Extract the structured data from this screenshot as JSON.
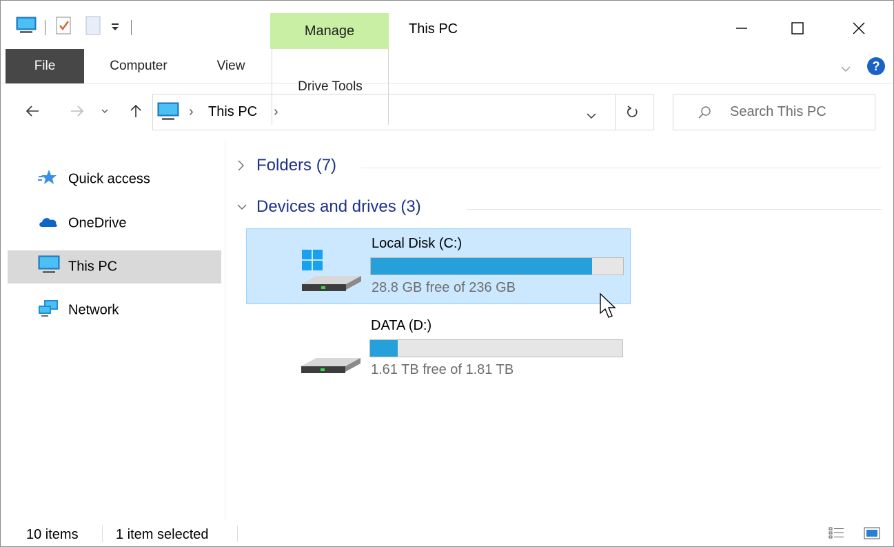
{
  "window": {
    "title": "This PC",
    "manage_label": "Manage",
    "minimize_icon": "minimize-icon",
    "maximize_icon": "maximize-icon",
    "close_icon": "close-icon"
  },
  "ribbon": {
    "tabs": [
      {
        "label": "File",
        "active": true
      },
      {
        "label": "Computer"
      },
      {
        "label": "View"
      },
      {
        "label": "Drive Tools"
      }
    ],
    "help_icon": "help-icon"
  },
  "address": {
    "path": "This PC",
    "search_placeholder": "Search This PC"
  },
  "sidebar": {
    "items": [
      {
        "label": "Quick access",
        "icon": "star-icon"
      },
      {
        "label": "OneDrive",
        "icon": "cloud-icon"
      },
      {
        "label": "This PC",
        "icon": "computer-icon",
        "selected": true
      },
      {
        "label": "Network",
        "icon": "network-icon"
      }
    ]
  },
  "content": {
    "groups": [
      {
        "title": "Folders (7)",
        "expanded": false
      },
      {
        "title": "Devices and drives (3)",
        "expanded": true
      }
    ],
    "drives": [
      {
        "name": "Local Disk (C:)",
        "free_text": "28.8 GB free of 236 GB",
        "used_fraction": 0.878,
        "selected": true
      },
      {
        "name": "DATA (D:)",
        "free_text": "1.61 TB free of 1.81 TB",
        "used_fraction": 0.11,
        "selected": false
      }
    ]
  },
  "statusbar": {
    "item_count": "10 items",
    "selection": "1 item selected"
  },
  "colors": {
    "accent": "#26a0da",
    "manage_tab": "#c8efa4",
    "group_title": "#1e3287",
    "selection_bg": "#cce8ff"
  }
}
